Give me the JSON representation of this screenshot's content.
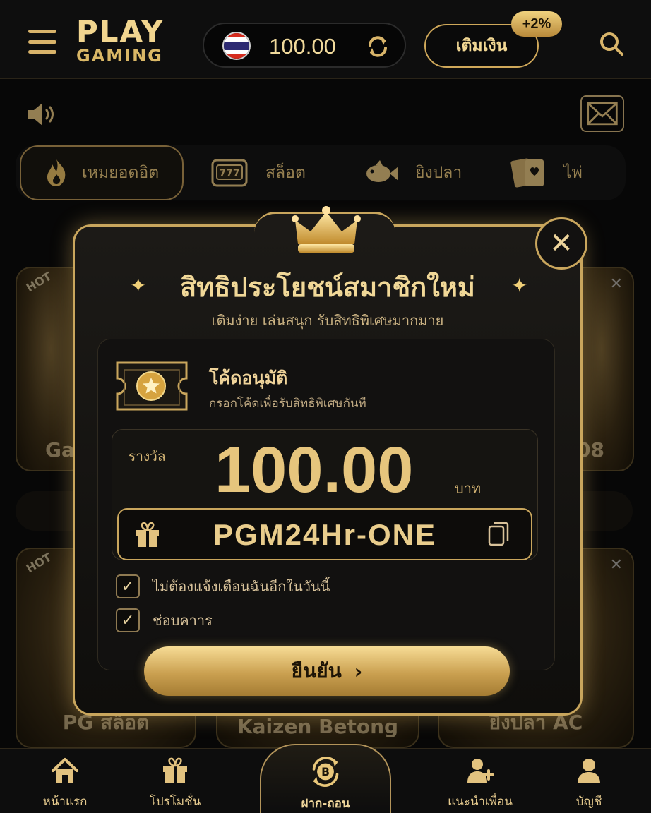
{
  "header": {
    "logo_top": "PLAY",
    "logo_bottom": "GAMING",
    "balance": "100.00",
    "topup_label": "เติมเงิน",
    "bonus_badge": "+2%"
  },
  "tabs": [
    {
      "label": "เหมยอดอิต",
      "icon": "flame-icon",
      "active": true
    },
    {
      "label": "สล็อต",
      "icon": "slot-machine-icon",
      "active": false
    },
    {
      "label": "ยิงปลา",
      "icon": "fish-icon",
      "active": false
    },
    {
      "label": "ไพ่",
      "icon": "cards-icon",
      "active": false
    }
  ],
  "background_cards": {
    "row1_left_label": "Ga",
    "row1_right_label": "08",
    "row2_left_label": "PG  สล็อต",
    "row2_mid_label": "Kaizen Betong",
    "row2_right_label": "ยิงปลา AC",
    "hot_badge": "HOT",
    "dismiss_glyph": "✕"
  },
  "modal": {
    "title": "สิทธิประโยชน์สมาชิกใหม่",
    "subtitle": "เติมง่าย เล่นสนุก รับสิทธิพิเศษมากมาย",
    "sparkle_glyph": "✦",
    "close_glyph": "✕",
    "code_title": "โค้ดอนุมัติ",
    "code_description": "กรอกโค้ดเพื่อรับสิทธิพิเศษกันที",
    "reward_label": "รางวัล",
    "reward_amount": "100.00",
    "reward_unit": "บาท",
    "promo_code": "PGM24Hr-ONE",
    "checkbox_1": {
      "label": "ไม่ต้องแจ้งเตือนฉันอีกในวันนี้",
      "checked": true
    },
    "checkbox_2": {
      "label": "ช่อบคาาร",
      "checked": true
    },
    "check_glyph": "✓",
    "confirm_label": "ยืนยัน",
    "confirm_arrow": "›"
  },
  "bottom_nav": [
    {
      "label": "หน้าแรก",
      "icon": "home-icon"
    },
    {
      "label": "โปรโมชั่น",
      "icon": "gift-icon"
    },
    {
      "label": "ฝาก-ถอน",
      "icon": "bitcoin-exchange-icon"
    },
    {
      "label": "แนะนำเพื่อน",
      "icon": "add-friend-icon"
    },
    {
      "label": "บัญชี",
      "icon": "account-icon"
    }
  ],
  "colors": {
    "accent_gold": "#c9a65d",
    "background": "#0b0b0b",
    "text_gold": "#e9c77a"
  }
}
